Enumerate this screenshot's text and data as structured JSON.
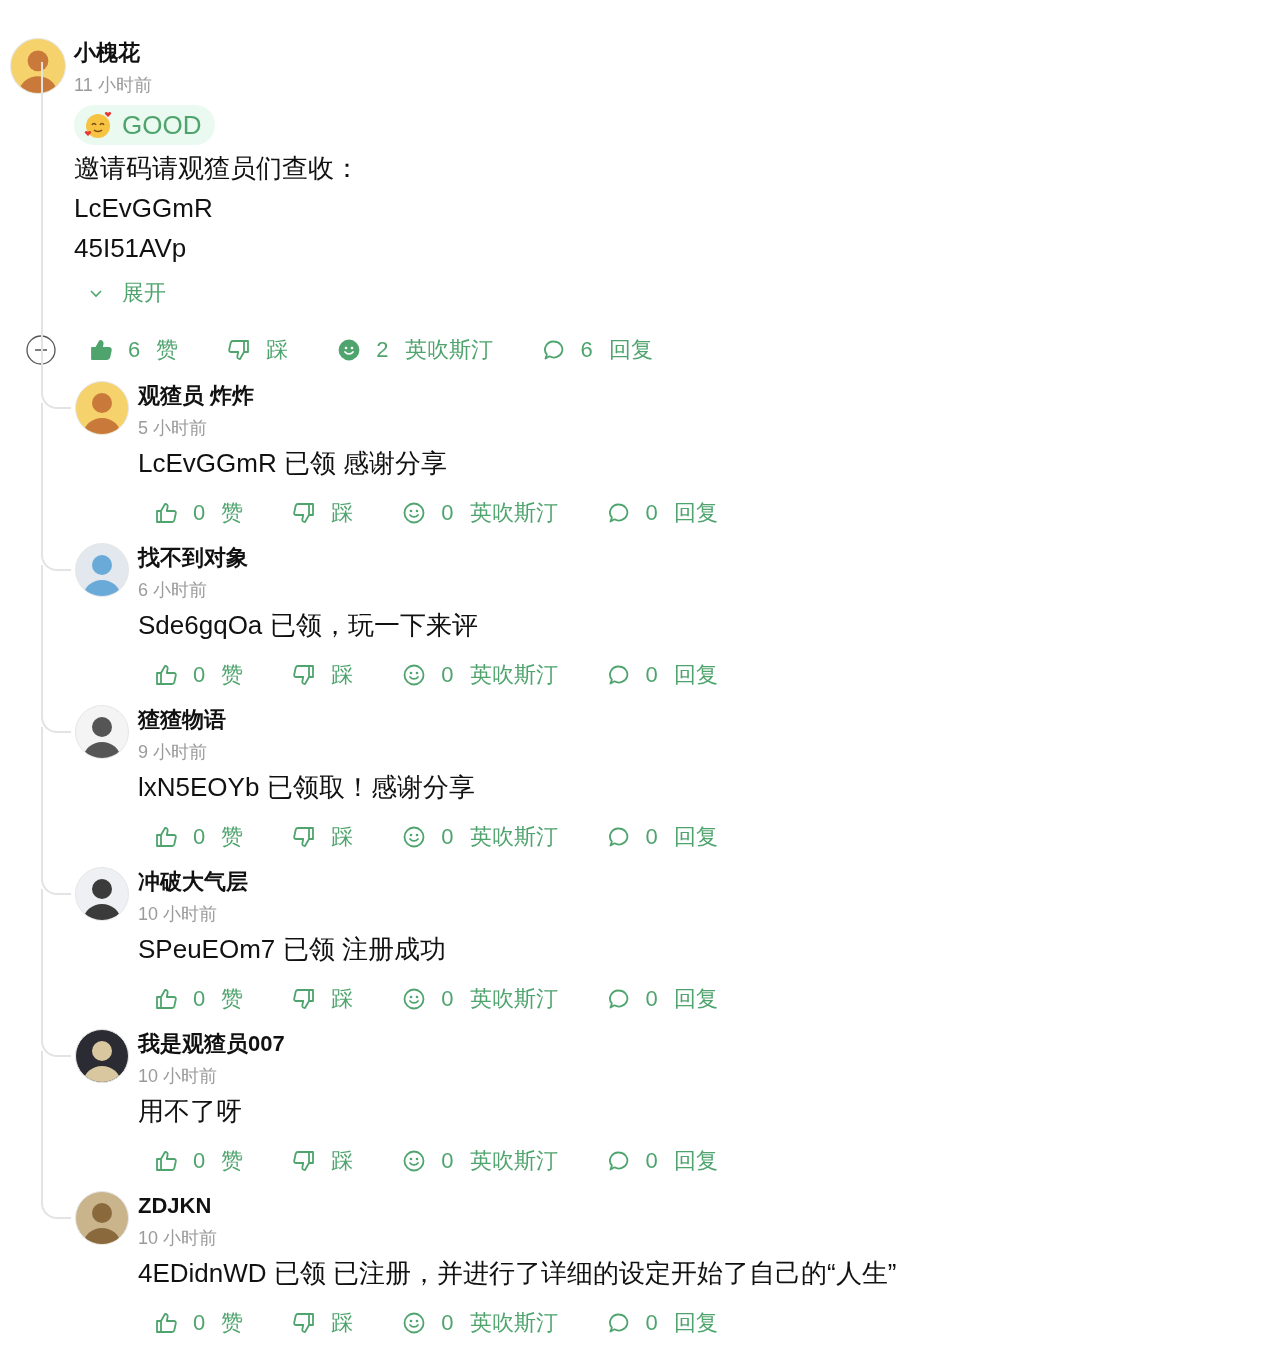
{
  "comment": {
    "author": "小槐花",
    "time": "11 小时前",
    "badge": {
      "label": "GOOD"
    },
    "lines": [
      "邀请码请观猹员们查收：",
      "LcEvGGmR",
      "45I51AVp"
    ],
    "expand": {
      "label": "展开",
      "expanded": false
    },
    "actions": {
      "liked": true,
      "likes": "6",
      "like_label": "赞",
      "dislike_label": "踩",
      "reacted": true,
      "reactions": "2",
      "reaction_label": "英吹斯汀",
      "replies": "6",
      "reply_label": "回复"
    },
    "replies": [
      {
        "author": "观猹员 炸炸",
        "time": "5 小时前",
        "text": "LcEvGGmR 已领 感谢分享",
        "actions": {
          "liked": false,
          "likes": "0",
          "like_label": "赞",
          "dislike_label": "踩",
          "reacted": false,
          "reactions": "0",
          "reaction_label": "英吹斯汀",
          "replies": "0",
          "reply_label": "回复"
        }
      },
      {
        "author": "找不到对象",
        "time": "6 小时前",
        "text": "Sde6gqOa 已领，玩一下来评",
        "actions": {
          "liked": false,
          "likes": "0",
          "like_label": "赞",
          "dislike_label": "踩",
          "reacted": false,
          "reactions": "0",
          "reaction_label": "英吹斯汀",
          "replies": "0",
          "reply_label": "回复"
        }
      },
      {
        "author": "猹猹物语",
        "time": "9 小时前",
        "text": "lxN5EOYb 已领取！感谢分享",
        "actions": {
          "liked": false,
          "likes": "0",
          "like_label": "赞",
          "dislike_label": "踩",
          "reacted": false,
          "reactions": "0",
          "reaction_label": "英吹斯汀",
          "replies": "0",
          "reply_label": "回复"
        }
      },
      {
        "author": "冲破大气层",
        "time": "10 小时前",
        "text": "SPeuEOm7 已领 注册成功",
        "actions": {
          "liked": false,
          "likes": "0",
          "like_label": "赞",
          "dislike_label": "踩",
          "reacted": false,
          "reactions": "0",
          "reaction_label": "英吹斯汀",
          "replies": "0",
          "reply_label": "回复"
        }
      },
      {
        "author": "我是观猹员007",
        "time": "10 小时前",
        "text": "用不了呀",
        "actions": {
          "liked": false,
          "likes": "0",
          "like_label": "赞",
          "dislike_label": "踩",
          "reacted": false,
          "reactions": "0",
          "reaction_label": "英吹斯汀",
          "replies": "0",
          "reply_label": "回复"
        }
      },
      {
        "author": "ZDJKN",
        "time": "10 小时前",
        "text": "4EDidnWD 已领 已注册，并进行了详细的设定开始了自己的“人生”",
        "actions": {
          "liked": false,
          "likes": "0",
          "like_label": "赞",
          "dislike_label": "踩",
          "reacted": false,
          "reactions": "0",
          "reaction_label": "英吹斯汀",
          "replies": "0",
          "reply_label": "回复"
        }
      }
    ]
  }
}
